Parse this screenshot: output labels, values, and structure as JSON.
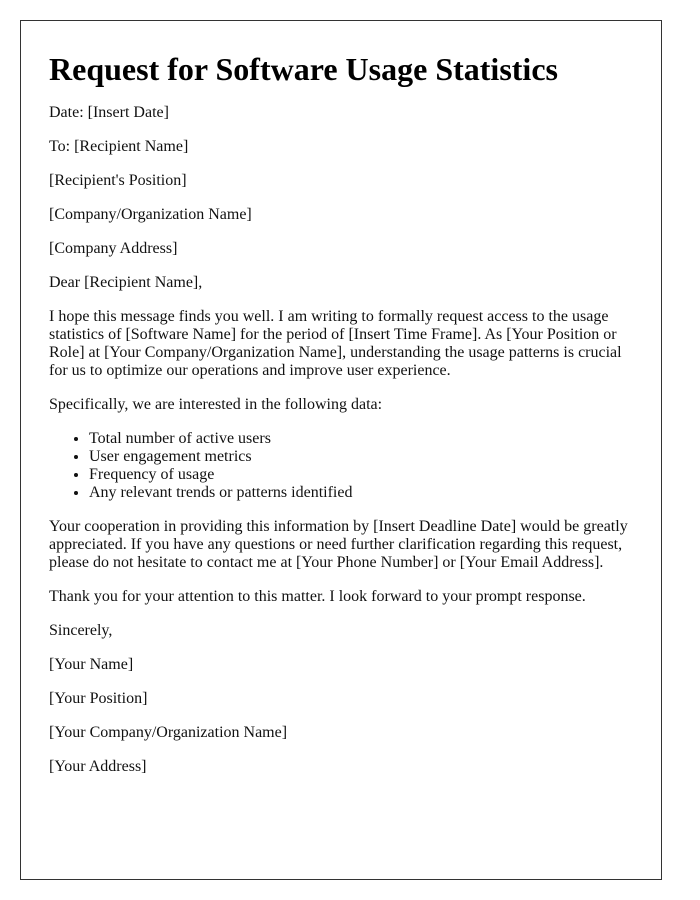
{
  "title": "Request for Software Usage Statistics",
  "header_lines": [
    "Date: [Insert Date]",
    "To: [Recipient Name]",
    "[Recipient's Position]",
    "[Company/Organization Name]",
    "[Company Address]"
  ],
  "salutation": "Dear [Recipient Name],",
  "intro_paragraph": "I hope this message finds you well. I am writing to formally request access to the usage statistics of [Software Name] for the period of [Insert Time Frame]. As [Your Position or Role] at [Your Company/Organization Name], understanding the usage patterns is crucial for us to optimize our operations and improve user experience.",
  "list_intro": "Specifically, we are interested in the following data:",
  "data_items": [
    "Total number of active users",
    "User engagement metrics",
    "Frequency of usage",
    "Any relevant trends or patterns identified"
  ],
  "cooperation_paragraph": "Your cooperation in providing this information by [Insert Deadline Date] would be greatly appreciated. If you have any questions or need further clarification regarding this request, please do not hesitate to contact me at [Your Phone Number] or [Your Email Address].",
  "thanks_paragraph": "Thank you for your attention to this matter. I look forward to your prompt response.",
  "closing": "Sincerely,",
  "signature_lines": [
    "[Your Name]",
    "[Your Position]",
    "[Your Company/Organization Name]",
    "[Your Address]"
  ]
}
